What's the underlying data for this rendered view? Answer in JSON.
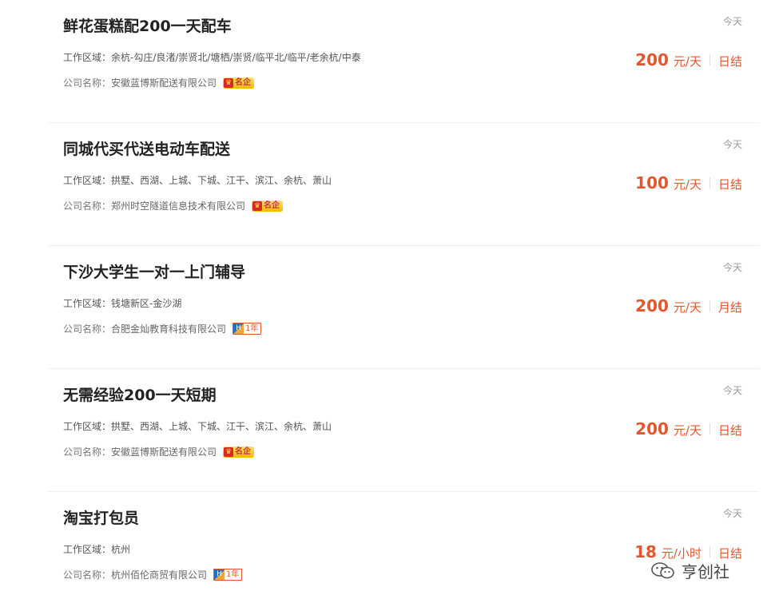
{
  "labels": {
    "area_prefix": "工作区域：",
    "company_prefix": "公司名称："
  },
  "jobs": [
    {
      "title": "鲜花蛋糕配200一天配车",
      "area": "余杭-勾庄/良渚/崇贤北/塘栖/崇贤/临平北/临平/老余杭/中泰",
      "company": "安徽蓝博斯配送有限公司",
      "badge": "名企",
      "date": "今天",
      "amount": "200",
      "unit": "元/天",
      "settle": "日结"
    },
    {
      "title": "同城代买代送电动车配送",
      "area": "拱墅、西湖、上城、下城、江干、滨江、余杭、萧山",
      "company": "郑州时空隧道信息技术有限公司",
      "badge": "名企",
      "date": "今天",
      "amount": "100",
      "unit": "元/天",
      "settle": "日结"
    },
    {
      "title": "下沙大学生一对一上门辅导",
      "area": "钱塘新区-金沙湖",
      "company": "合肥金灿教育科技有限公司",
      "badge": "1年",
      "date": "今天",
      "amount": "200",
      "unit": "元/天",
      "settle": "月结"
    },
    {
      "title": "无需经验200一天短期",
      "area": "拱墅、西湖、上城、下城、江干、滨江、余杭、萧山",
      "company": "安徽蓝博斯配送有限公司",
      "badge": "名企",
      "date": "今天",
      "amount": "200",
      "unit": "元/天",
      "settle": "日结"
    },
    {
      "title": "淘宝打包员",
      "area": "杭州",
      "company": "杭州佰伦商贸有限公司",
      "badge": "1年",
      "date": "今天",
      "amount": "18",
      "unit": "元/小时",
      "settle": "日结"
    }
  ],
  "watermark": {
    "text": "亨创社",
    "icon": "wechat-icon"
  },
  "colors": {
    "accent": "#e4572e",
    "badge_gold": "#f7b500",
    "badge_blue": "#1e6fd0"
  }
}
